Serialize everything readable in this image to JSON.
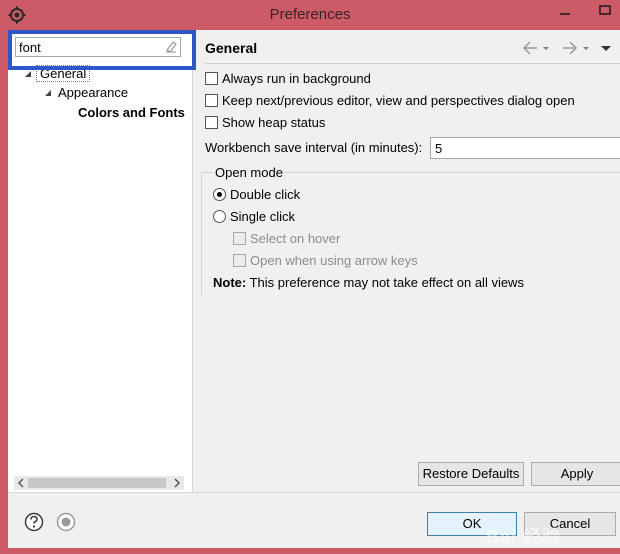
{
  "window": {
    "title": "Preferences",
    "icon": "gear-icon",
    "controls": [
      "minimize-icon",
      "maximize-icon"
    ]
  },
  "filter": {
    "value": "font",
    "clear_icon": "eraser-icon"
  },
  "tree": {
    "items": [
      {
        "label": "General",
        "expanded": true,
        "level": 0
      },
      {
        "label": "Appearance",
        "expanded": true,
        "level": 1
      },
      {
        "label": "Colors and Fonts",
        "level": 2,
        "emphasized": true
      }
    ]
  },
  "page": {
    "title": "General",
    "nav_icons": [
      "back-arrow-icon",
      "back-dropdown-icon",
      "forward-arrow-icon",
      "forward-dropdown-icon",
      "view-menu-icon"
    ]
  },
  "options": {
    "always_run_background": {
      "label": "Always run in background",
      "checked": false
    },
    "keep_next_prev": {
      "label": "Keep next/previous editor, view and perspectives dialog open",
      "checked": false
    },
    "show_heap": {
      "label": "Show heap status",
      "checked": false
    },
    "save_interval": {
      "label": "Workbench save interval (in minutes):",
      "value": "5"
    }
  },
  "open_mode": {
    "label": "Open mode",
    "double_click": {
      "label": "Double click",
      "selected": true
    },
    "single_click": {
      "label": "Single click",
      "selected": false
    },
    "select_on_hover": {
      "label": "Select on hover",
      "enabled": false
    },
    "open_arrow_keys": {
      "label": "Open when using arrow keys",
      "enabled": false
    },
    "note_label": "Note:",
    "note_text": "This preference may not take effect on all views"
  },
  "buttons": {
    "restore_defaults": "Restore Defaults",
    "apply": "Apply",
    "ok": "OK",
    "cancel": "Cancel"
  },
  "footer_icons": [
    "help-icon",
    "record-macro-icon"
  ],
  "watermark": "Bai 经验",
  "colors": {
    "window_frame": "#cc5b66",
    "highlight_border": "#2f56c8",
    "dialog_background": "#f0f0f0"
  }
}
